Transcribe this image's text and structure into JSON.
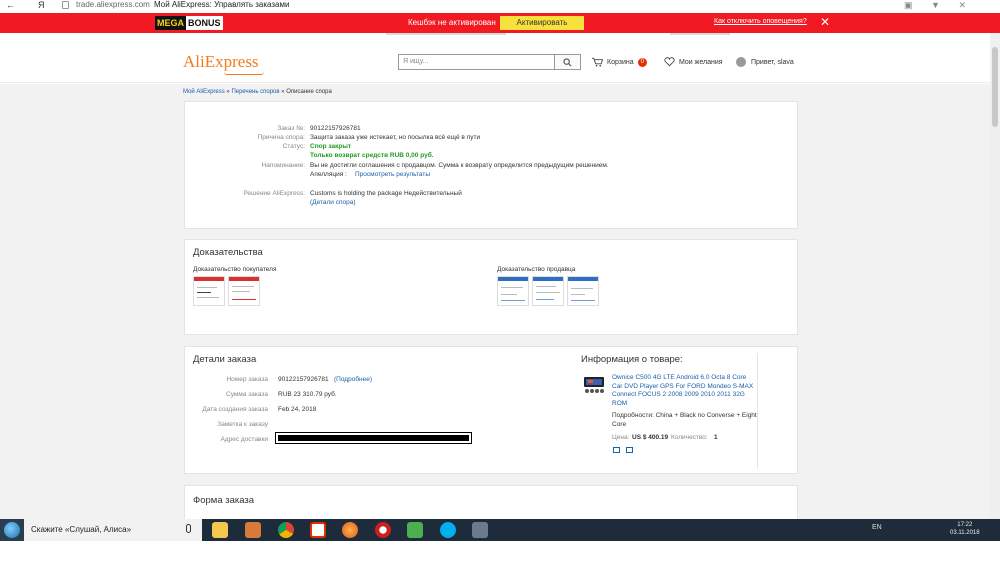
{
  "browser": {
    "back": "←",
    "tab_icon": "Я",
    "url": "trade.aliexpress.com",
    "page_title": "Мой AliExpress: Управлять заказами"
  },
  "megabonus": {
    "logo_mega": "MEGA",
    "logo_bonus": "BONUS",
    "text": "Кешбэк не активирован",
    "button": "Активировать",
    "link": "Как отключить оповещения?",
    "close": "✕"
  },
  "header": {
    "logo": "AliExpress",
    "search_placeholder": "Я ищу...",
    "cart_label": "Корзина",
    "cart_count": "0",
    "wishlist_label": "Мои желания",
    "greeting": "Привет, slava"
  },
  "breadcrumb": {
    "item1": "Мой AliExpress",
    "sep1": " » ",
    "item2": "Перечень споров",
    "sep2": " » ",
    "item3": "Описание спора"
  },
  "dispute": {
    "order_no_label": "Заказ №:",
    "order_no": "90122157926781",
    "reason_label": "Причина спора:",
    "reason": "Защита заказа уже истекает, но посылка всё ещё в пути",
    "status_label": "Статус:",
    "status": "Спор закрыт",
    "status_detail": "Только возврат средств RUB 0,00 руб.",
    "reminder_label": "Напоминание:",
    "reminder": "Вы не достигли соглашения с продавцом. Сумма к возврату определится предыдущим решением.",
    "appeal_label": "Апелляция :",
    "appeal_link": "Просмотреть результаты",
    "decision_label": "Решение AliExpress:",
    "decision": "Customs is holding the package Недействительный",
    "details_link": "(Детали спора)"
  },
  "evidence": {
    "title": "Доказательства",
    "buyer": "Доказательство покупателя",
    "seller": "Доказательство продавца"
  },
  "order": {
    "title": "Детали заказа",
    "number_label": "Номер заказа",
    "number": "90122157926781",
    "more_link": "(Подробнее)",
    "sum_label": "Сумма заказа",
    "sum": "RUB 23 310.79 руб.",
    "date_label": "Дата создания заказа",
    "date": "Feb 24, 2018",
    "note_label": "Заметка к заказу",
    "address_label": "Адрес доставки"
  },
  "product": {
    "title": "Информация о товаре:",
    "name": "Ownice C500 4G LTE Android 6.0 Octa 8 Core Car DVD Player GPS For FORD Mondeo S-MAX Connect FOCUS 2 2008 2009 2010 2011 32G ROM",
    "details": "Подробности: China + Black no Converse + Eight Core",
    "price_label": "Цена:",
    "price": "US $ 400.19",
    "qty_label": "Количество:",
    "qty": "1"
  },
  "form": {
    "title": "Форма заказа"
  },
  "taskbar": {
    "cortana": "Скажите «Слушай, Алиса»",
    "lang": "EN",
    "time": "17:22",
    "date": "03.11.2018"
  },
  "colors": {
    "megabar": "#f11a22",
    "accent": "#f47a20",
    "link": "#1a5fa8",
    "success": "#1e9b1e"
  }
}
